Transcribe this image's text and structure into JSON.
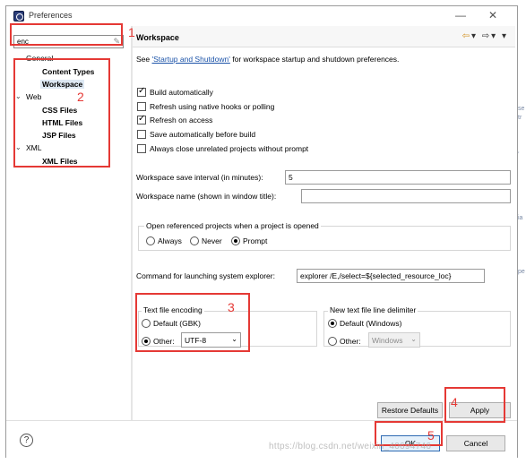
{
  "window": {
    "title": "Preferences",
    "minimize": "—",
    "maximize": "☐",
    "close": "✕"
  },
  "filter": {
    "value": "enc"
  },
  "tree": [
    {
      "label": "General",
      "twist": "⌄"
    },
    {
      "label": "Content Types"
    },
    {
      "label": "Workspace"
    },
    {
      "label": "Web",
      "twist": "⌄"
    },
    {
      "label": "CSS Files"
    },
    {
      "label": "HTML Files"
    },
    {
      "label": "JSP Files"
    },
    {
      "label": "XML",
      "twist": "⌄"
    },
    {
      "label": "XML Files"
    }
  ],
  "page": {
    "title": "Workspace",
    "nav": {
      "back": "⇦",
      "back_menu": "▾",
      "fwd": "⇨",
      "fwd_menu": "▾",
      "menu": "▾"
    },
    "see_prefix": "See ",
    "see_link": "'Startup and Shutdown'",
    "see_suffix": " for workspace startup and shutdown preferences.",
    "checks": [
      {
        "label": "Build automatically",
        "checked": true
      },
      {
        "label": "Refresh using native hooks or polling",
        "checked": false
      },
      {
        "label": "Refresh on access",
        "checked": true
      },
      {
        "label": "Save automatically before build",
        "checked": false
      },
      {
        "label": "Always close unrelated projects without prompt",
        "checked": false
      }
    ],
    "save_interval_label": "Workspace save interval (in minutes):",
    "save_interval_value": "5",
    "ws_name_label": "Workspace name (shown in window title):",
    "ws_name_value": "",
    "open_group": {
      "label": "Open referenced projects when a project is opened",
      "options": [
        "Always",
        "Never",
        "Prompt"
      ],
      "selected": "Prompt"
    },
    "explorer_label": "Command for launching system explorer:",
    "explorer_value": "explorer /E,/select=${selected_resource_loc}",
    "encoding": {
      "label": "Text file encoding",
      "default_label": "Default (GBK)",
      "other_label": "Other:",
      "other_value": "UTF-8",
      "selected": "Other"
    },
    "delimiter": {
      "label": "New text file line delimiter",
      "default_label": "Default (Windows)",
      "other_label": "Other:",
      "other_value": "Windows",
      "selected": "Default"
    },
    "restore_defaults": "Restore Defaults",
    "apply": "Apply"
  },
  "footer": {
    "help": "?",
    "ok": "OK",
    "cancel": "Cancel"
  },
  "annotations": [
    "1",
    "2",
    "3",
    "4",
    "5"
  ],
  "background_edge": [
    "se",
    "tr",
    "ia",
    "pe",
    "ʼ"
  ],
  "watermark": "https://blog.csdn.net/weixin_40694746"
}
